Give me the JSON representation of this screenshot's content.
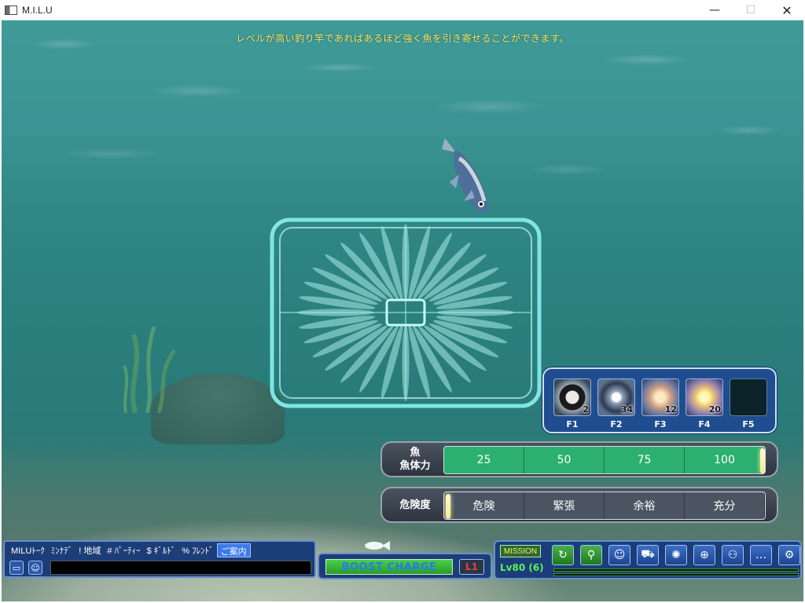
{
  "window": {
    "title": "M.I.L.U",
    "minimize_glyph": "—",
    "maximize_glyph": "☐",
    "close_glyph": "✕"
  },
  "hud": {
    "hint": "レベルが高い釣り竿であればあるほど強く魚を引き寄せることができます。"
  },
  "skills": [
    {
      "icon": "dark-lure-orb-icon",
      "key": "F1",
      "count": "2"
    },
    {
      "icon": "star-orb-icon",
      "key": "F2",
      "count": "34"
    },
    {
      "icon": "glow-orb-icon",
      "key": "F3",
      "count": "12"
    },
    {
      "icon": "sparkle-orb-icon",
      "key": "F4",
      "count": "20"
    },
    {
      "icon": "empty-slot",
      "key": "F5",
      "count": ""
    }
  ],
  "fish_stamina": {
    "label_line1": "魚",
    "label_line2": "魚体力",
    "ticks": [
      "25",
      "50",
      "75",
      "100"
    ],
    "value_percent": 100,
    "fill_color": "#2cb070"
  },
  "danger": {
    "label": "危険度",
    "ticks": [
      "危険",
      "緊張",
      "余裕",
      "充分"
    ],
    "value_percent": 0
  },
  "chat": {
    "tabs": [
      "MILUﾄｰｸ",
      "ﾐﾝﾅﾃﾞ",
      "! 地域",
      "# ﾊﾟｰﾃｨｰ",
      "$ ｷﾞﾙﾄﾞ",
      "% ﾌﾚﾝﾄﾞ",
      "ご案内"
    ],
    "active_tab": "ご案内",
    "input_value": ""
  },
  "boost": {
    "label": "BOOST CHARGE",
    "control_label": "L1"
  },
  "menu": {
    "mission_label": "MISSION",
    "level_text": "Lv80 (6)",
    "icons": [
      "return-icon",
      "character-icon",
      "profile-icon",
      "vehicle-icon",
      "skill-burst-icon",
      "add-friend-icon",
      "party-icon",
      "chat-bubble-icon",
      "settings-icon"
    ],
    "icon_glyphs": [
      "↻",
      "⚲",
      "☺",
      "⛟",
      "✺",
      "⊕",
      "⚇",
      "…",
      "⚙"
    ]
  }
}
